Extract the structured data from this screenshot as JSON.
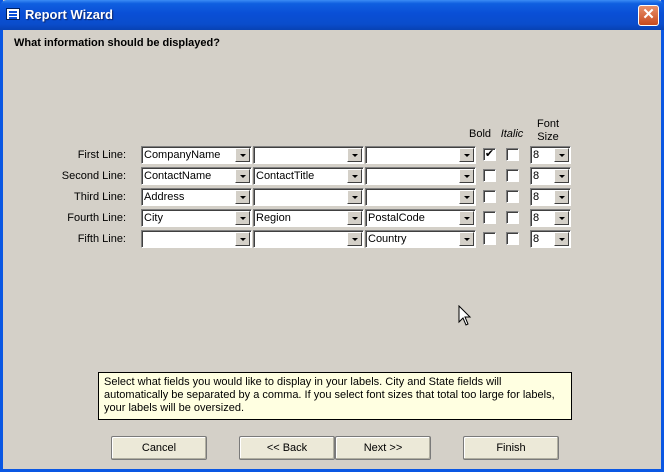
{
  "window": {
    "title": "Report Wizard",
    "close_glyph": "✕",
    "icon": "report-wizard-icon"
  },
  "question": "What information should be displayed?",
  "columns": {
    "bold": "Bold",
    "italic": "Italic",
    "font_size": "Font Size"
  },
  "rows": [
    {
      "label": "First Line:",
      "field1": "CompanyName",
      "field2": "",
      "field3": "",
      "bold": true,
      "italic": false,
      "size": "8"
    },
    {
      "label": "Second Line:",
      "field1": "ContactName",
      "field2": "ContactTitle",
      "field3": "",
      "bold": false,
      "italic": false,
      "size": "8"
    },
    {
      "label": "Third Line:",
      "field1": "Address",
      "field2": "",
      "field3": "",
      "bold": false,
      "italic": false,
      "size": "8"
    },
    {
      "label": "Fourth Line:",
      "field1": "City",
      "field2": "Region",
      "field3": "PostalCode",
      "bold": false,
      "italic": false,
      "size": "8"
    },
    {
      "label": "Fifth Line:",
      "field1": "",
      "field2": "",
      "field3": "Country",
      "bold": false,
      "italic": false,
      "size": "8"
    }
  ],
  "help_text": "Select what fields you would like to display in your labels.  City and State fields will automatically be separated by a comma.  If you select font sizes that total too large for labels, your labels will be oversized.",
  "buttons": {
    "cancel": "Cancel",
    "back": "<< Back",
    "next": "Next >>",
    "finish": "Finish"
  },
  "checkmark": "✔"
}
